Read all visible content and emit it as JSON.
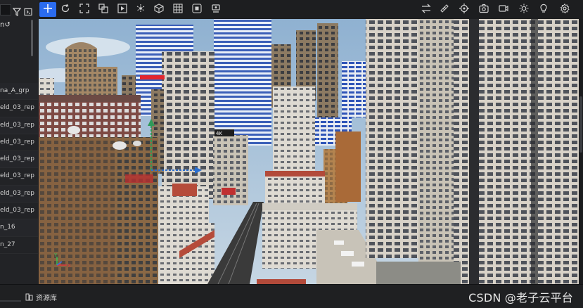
{
  "outliner": {
    "top_item": "n",
    "items": [
      "na_A_grp",
      "eld_03_rep",
      "eld_03_rep",
      "eld_03_rep",
      "eld_03_rep",
      "eld_03_rep",
      "eld_03_rep",
      "eld_03_rep",
      "n_16",
      "n_27"
    ]
  },
  "toolbar": {
    "left_tools": [
      "add-icon",
      "refresh-icon",
      "expand-icon",
      "scale-icon",
      "play-icon",
      "gizmo-icon",
      "cube-icon",
      "grid-icon",
      "focus-icon",
      "camera-bookmark-icon"
    ],
    "right_tools": [
      "transfer-icon",
      "measure-icon",
      "target-icon",
      "camera-icon",
      "video-icon",
      "sun-icon",
      "light-bulb-icon",
      "settings-icon"
    ],
    "accent_color": "#2b6cf0"
  },
  "viewport": {
    "billboard_text": "4K",
    "axis_labels": {
      "y": "Y",
      "x": "X"
    }
  },
  "bottom_panel": {
    "tab_label": "资源库"
  },
  "watermark": "CSDN @老子云平台"
}
